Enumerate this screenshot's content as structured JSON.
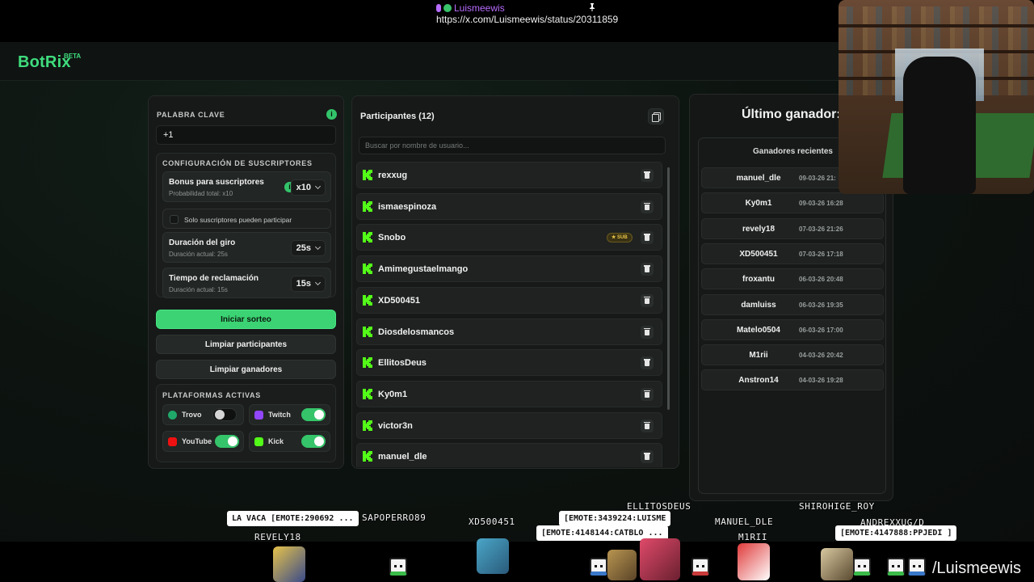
{
  "overlay_top": {
    "username": "Luismeewis",
    "url": "https://x.com/Luismeewis/status/20311859"
  },
  "app": {
    "brand": "BotRix",
    "brand_badge": "BETA"
  },
  "left_panel": {
    "keyword_label": "PALABRA CLAVE",
    "keyword_value": "+1",
    "subs_config_label": "CONFIGURACIÓN DE SUSCRIPTORES",
    "bonus_title": "Bonus para suscriptores",
    "bonus_sub": "Probabilidad total: x10",
    "bonus_value": "x10",
    "subs_only_label": "Solo suscriptores pueden participar",
    "spin_title": "Duración del giro",
    "spin_sub": "Duración actual: 25s",
    "spin_value": "25s",
    "claim_title": "Tiempo de reclamación",
    "claim_sub": "Duración actual: 15s",
    "claim_value": "15s",
    "start_button": "Iniciar sorteo",
    "clear_participants_button": "Limpiar participantes",
    "clear_winners_button": "Limpiar ganadores",
    "platforms_label": "PLATAFORMAS ACTIVAS",
    "platforms": [
      {
        "name": "Trovo",
        "enabled": false,
        "color": "#1fa86a"
      },
      {
        "name": "Twitch",
        "enabled": true,
        "color": "#9146ff"
      },
      {
        "name": "YouTube",
        "enabled": true,
        "color": "#ff0000"
      },
      {
        "name": "Kick",
        "enabled": true,
        "color": "#53fc18"
      }
    ]
  },
  "participants": {
    "title": "Participantes (12)",
    "search_placeholder": "Buscar por nombre de usuario...",
    "sub_badge": "SUB",
    "items": [
      {
        "name": "rexxug",
        "sub": false
      },
      {
        "name": "ismaespinoza",
        "sub": false
      },
      {
        "name": "Snobo",
        "sub": true
      },
      {
        "name": "Amimegustaelmango",
        "sub": false
      },
      {
        "name": "XD500451",
        "sub": false
      },
      {
        "name": "Diosdelosmancos",
        "sub": false
      },
      {
        "name": "EllitosDeus",
        "sub": false
      },
      {
        "name": "Ky0m1",
        "sub": false
      },
      {
        "name": "victor3n",
        "sub": false
      },
      {
        "name": "manuel_dle",
        "sub": false
      }
    ]
  },
  "winners": {
    "title": "Último ganador: -",
    "recent_label": "Ganadores recientes",
    "items": [
      {
        "name": "manuel_dle",
        "date": "09-03-26 21:"
      },
      {
        "name": "Ky0m1",
        "date": "09-03-26 16:28"
      },
      {
        "name": "revely18",
        "date": "07-03-26 21:26"
      },
      {
        "name": "XD500451",
        "date": "07-03-26 17:18"
      },
      {
        "name": "froxantu",
        "date": "06-03-26 20:48"
      },
      {
        "name": "damluiss",
        "date": "06-03-26 19:35"
      },
      {
        "name": "Matelo0504",
        "date": "06-03-26 17:00"
      },
      {
        "name": "M1rii",
        "date": "04-03-26 20:42"
      },
      {
        "name": "Anstron14",
        "date": "04-03-26 19:28"
      }
    ]
  },
  "chat_overlay": {
    "names": [
      "REVELY18",
      "SAPOPERRO89",
      "XD500451",
      "ELLITOSDEUS",
      "MANUEL_DLE",
      "M1RII",
      "SHIROHIGE_ROY",
      "ANDREXXUG/D"
    ],
    "bubbles": [
      "LA VACA [EMOTE:290692 ...",
      "[EMOTE:3439224:LUISME",
      "[EMOTE:4148144:CATBLO ...",
      "[EMOTE:4147888:PPJEDI ]"
    ],
    "channel": "/Luismeewis"
  }
}
